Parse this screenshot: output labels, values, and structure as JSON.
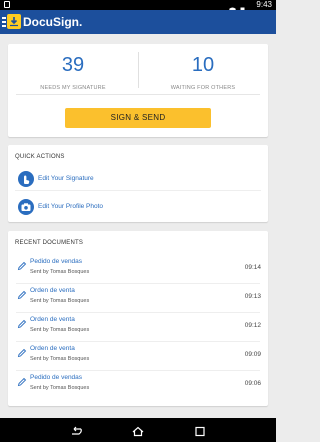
{
  "status_bar": {
    "time": "9:43"
  },
  "app": {
    "brand": "DocuSign."
  },
  "stats": {
    "needs_signature": {
      "count": "39",
      "label": "NEEDS MY SIGNATURE"
    },
    "waiting_others": {
      "count": "10",
      "label": "WAITING FOR OTHERS"
    }
  },
  "sign_send": {
    "label": "SIGN & SEND"
  },
  "quick_actions": {
    "title": "QUICK ACTIONS",
    "items": [
      {
        "label": "Edit Your Signature",
        "icon": "hand-pen-icon"
      },
      {
        "label": "Edit Your Profile Photo",
        "icon": "camera-icon"
      }
    ]
  },
  "recent": {
    "title": "RECENT DOCUMENTS",
    "docs": [
      {
        "title": "Pedido de vendas",
        "sender": "Sent by Tomas Bosques",
        "time": "09:14"
      },
      {
        "title": "Orden de venta",
        "sender": "Sent by Tomas Bosques",
        "time": "09:13"
      },
      {
        "title": "Orden de venta",
        "sender": "Sent by Tomas Bosques",
        "time": "09:12"
      },
      {
        "title": "Orden de venta",
        "sender": "Sent by Tomas Bosques",
        "time": "09:09"
      },
      {
        "title": "Pedido de vendas",
        "sender": "Sent by Tomas Bosques",
        "time": "09:06"
      }
    ]
  },
  "colors": {
    "brand_blue": "#1c4f9c",
    "link_blue": "#2a6dbf",
    "button_yellow": "#fbc02d"
  }
}
